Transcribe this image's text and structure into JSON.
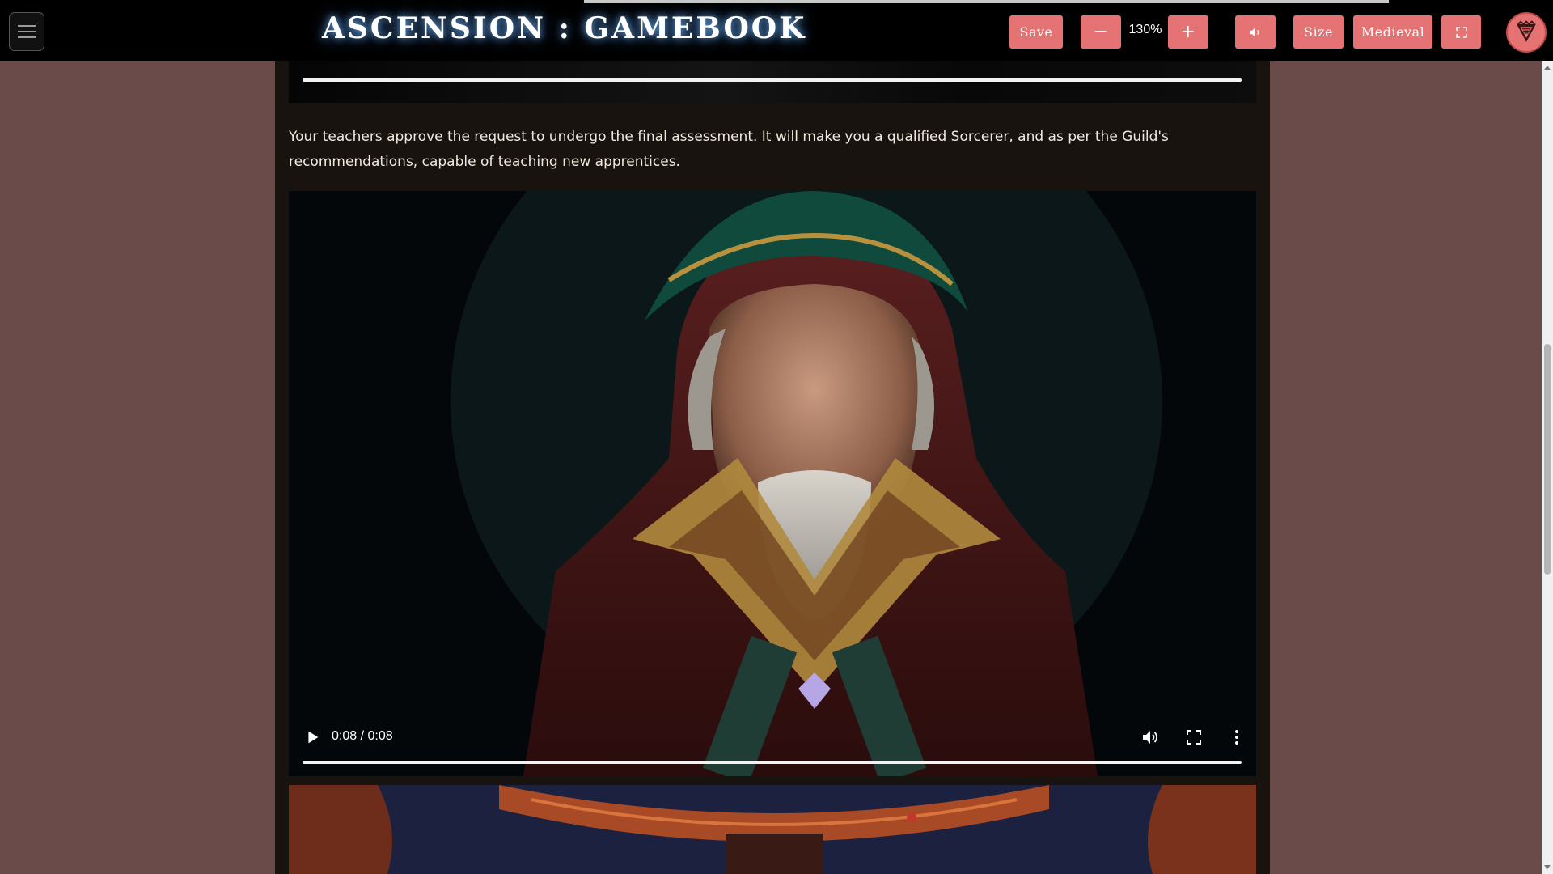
{
  "header": {
    "title": "ASCENSION : GAMEBOOK",
    "save_label": "Save",
    "zoom_out_label": "−",
    "zoom_value": "130%",
    "zoom_in_label": "+",
    "size_label": "Size",
    "theme_label": "Medieval",
    "sound_icon": "speaker-icon",
    "fullscreen_icon": "expand-icon",
    "logo_icon": "shield-logo-icon"
  },
  "story": {
    "paragraph": "Your teachers approve the request to undergo the final assessment. It will make you a qualified Sorcerer, and as per the Guild's recommendations, capable of teaching new apprentices."
  },
  "video": {
    "time": "0:08 / 0:08",
    "progress": 1.0
  },
  "colors": {
    "accent": "#e57373",
    "page_bg": "#6b4a4a",
    "content_bg": "#191310",
    "header_bg": "#000000"
  }
}
